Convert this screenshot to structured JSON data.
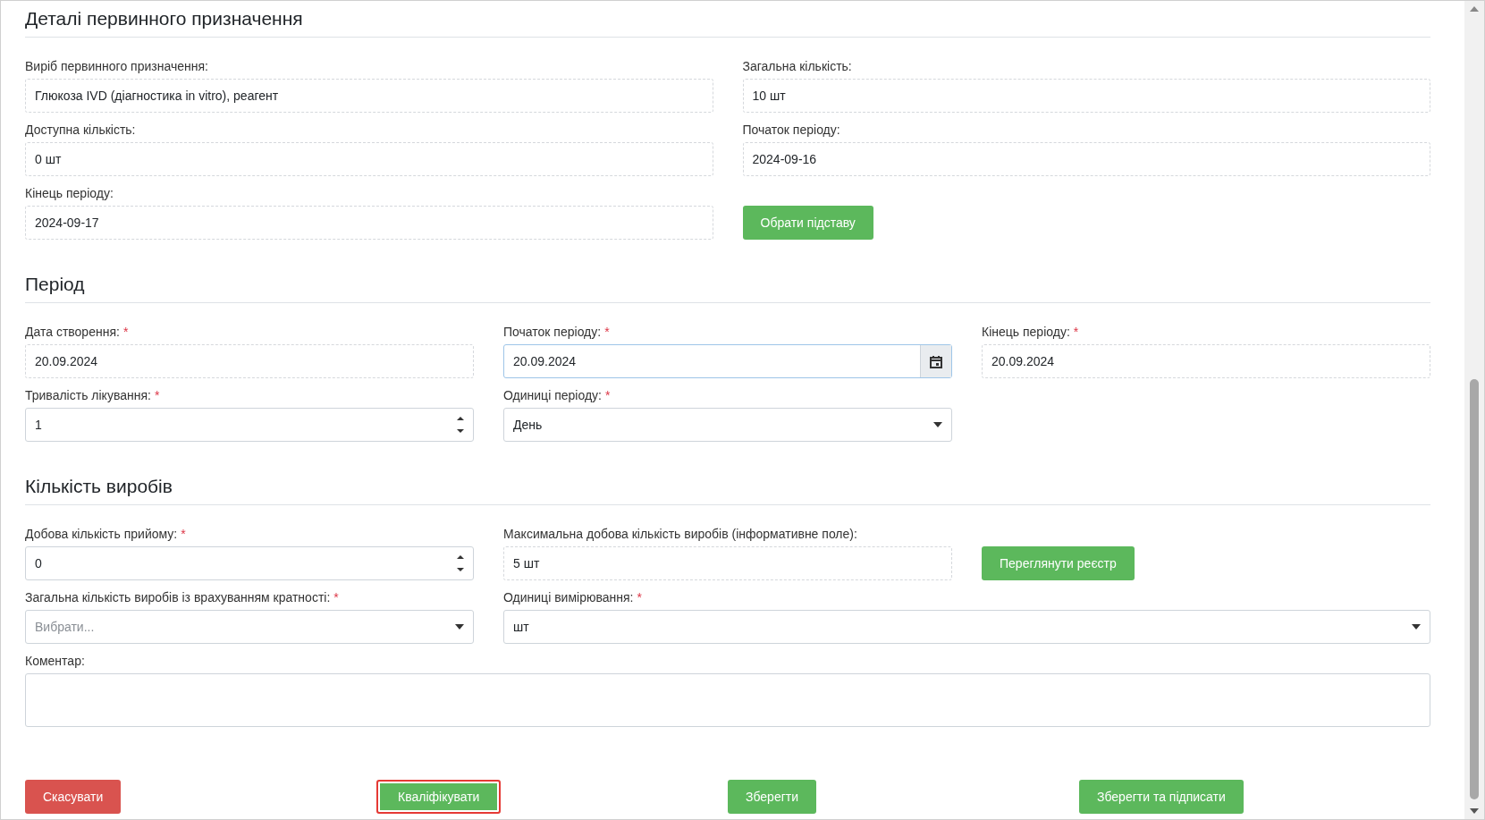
{
  "sections": [
    {
      "title": "Деталі первинного призначення",
      "rows": [
        [
          {
            "kind": "readonly",
            "label": "Виріб первинного призначення:",
            "value": "Глюкоза IVD (діагностика in vitro), реагент"
          },
          {
            "kind": "readonly",
            "label": "Загальна кількість:",
            "value": "10 шт"
          }
        ],
        [
          {
            "kind": "readonly",
            "label": "Доступна кількість:",
            "value": "0 шт"
          },
          {
            "kind": "readonly",
            "label": "Початок періоду:",
            "value": "2024-09-16"
          }
        ],
        [
          {
            "kind": "readonly",
            "label": "Кінець періоду:",
            "value": "2024-09-17"
          },
          {
            "kind": "button",
            "text": "Обрати підставу"
          }
        ]
      ]
    },
    {
      "title": "Період",
      "rows": [
        [
          {
            "kind": "readonly",
            "label": "Дата створення:",
            "asterisk": "*",
            "value": "20.09.2024"
          },
          {
            "kind": "date",
            "label": "Початок періоду:",
            "asterisk": "*",
            "value": "20.09.2024"
          },
          {
            "kind": "readonly",
            "label": "Кінець періоду:",
            "asterisk": "*",
            "value": "20.09.2024"
          }
        ],
        [
          {
            "kind": "number",
            "label": "Тривалість лікування:",
            "asterisk": "*",
            "value": "1"
          },
          {
            "kind": "select",
            "label": "Одиниці періоду:",
            "asterisk": "*",
            "value": "День"
          }
        ]
      ]
    },
    {
      "title": "Кількість виробів",
      "rows": [
        [
          {
            "kind": "number",
            "label": "Добова кількість прийому:",
            "asterisk": "*",
            "value": "0"
          },
          {
            "kind": "readonly",
            "label": "Максимальна добова кількість виробів (інформативне поле):",
            "value": "5 шт"
          },
          {
            "kind": "button",
            "text": "Переглянути реєстр"
          }
        ],
        [
          {
            "kind": "select",
            "label": "Загальна кількість виробів із врахуванням кратності:",
            "asterisk": "*",
            "placeholder": "Вибрати..."
          },
          {
            "kind": "select",
            "label": "Одиниці вимірювання:",
            "asterisk": "*",
            "value": "шт",
            "wide": true
          }
        ],
        [
          {
            "kind": "textarea",
            "label": "Коментар:",
            "wide": true
          }
        ]
      ]
    }
  ],
  "footer": [
    {
      "text": "Скасувати",
      "kind": "danger",
      "highlighted": false
    },
    {
      "text": "Кваліфікувати",
      "kind": "success",
      "highlighted": true
    },
    {
      "text": "Зберегти",
      "kind": "success",
      "highlighted": false
    },
    {
      "text": "Зберегти та підписати",
      "kind": "success",
      "highlighted": false
    }
  ]
}
